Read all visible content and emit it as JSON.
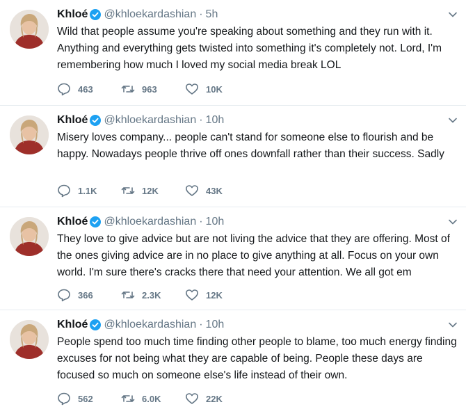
{
  "tweets": [
    {
      "name": "Khloé",
      "handle": "@khloekardashian",
      "separator": "·",
      "time": "5h",
      "text": "Wild that people assume you're speaking about something and they run with it. Anything and everything gets twisted into something it's completely not. Lord, I'm remembering how much I loved my social media break LOL",
      "replies": "463",
      "retweets": "963",
      "likes": "10K"
    },
    {
      "name": "Khloé",
      "handle": "@khloekardashian",
      "separator": "·",
      "time": "10h",
      "text": "Misery loves company... people can't stand for someone else to flourish and be happy. Nowadays people thrive off ones downfall rather than their success. Sadly",
      "replies": "1.1K",
      "retweets": "12K",
      "likes": "43K"
    },
    {
      "name": "Khloé",
      "handle": "@khloekardashian",
      "separator": "·",
      "time": "10h",
      "text": "They love to give advice but are not living the advice that they are offering. Most of the ones giving advice are in no place to give anything at all. Focus on your own world. I'm sure there's cracks there that need your attention. We all got em",
      "replies": "366",
      "retweets": "2.3K",
      "likes": "12K"
    },
    {
      "name": "Khloé",
      "handle": "@khloekardashian",
      "separator": "·",
      "time": "10h",
      "text": "People spend too much time finding other people to blame, too much energy finding excuses for not being what they are capable of being. People these days are focused so much on someone else's life instead of their own.",
      "replies": "562",
      "retweets": "6.0K",
      "likes": "22K"
    }
  ],
  "colors": {
    "verified": "#1da1f2",
    "muted": "#657786",
    "text": "#14171a",
    "divider": "#e6ecf0"
  }
}
